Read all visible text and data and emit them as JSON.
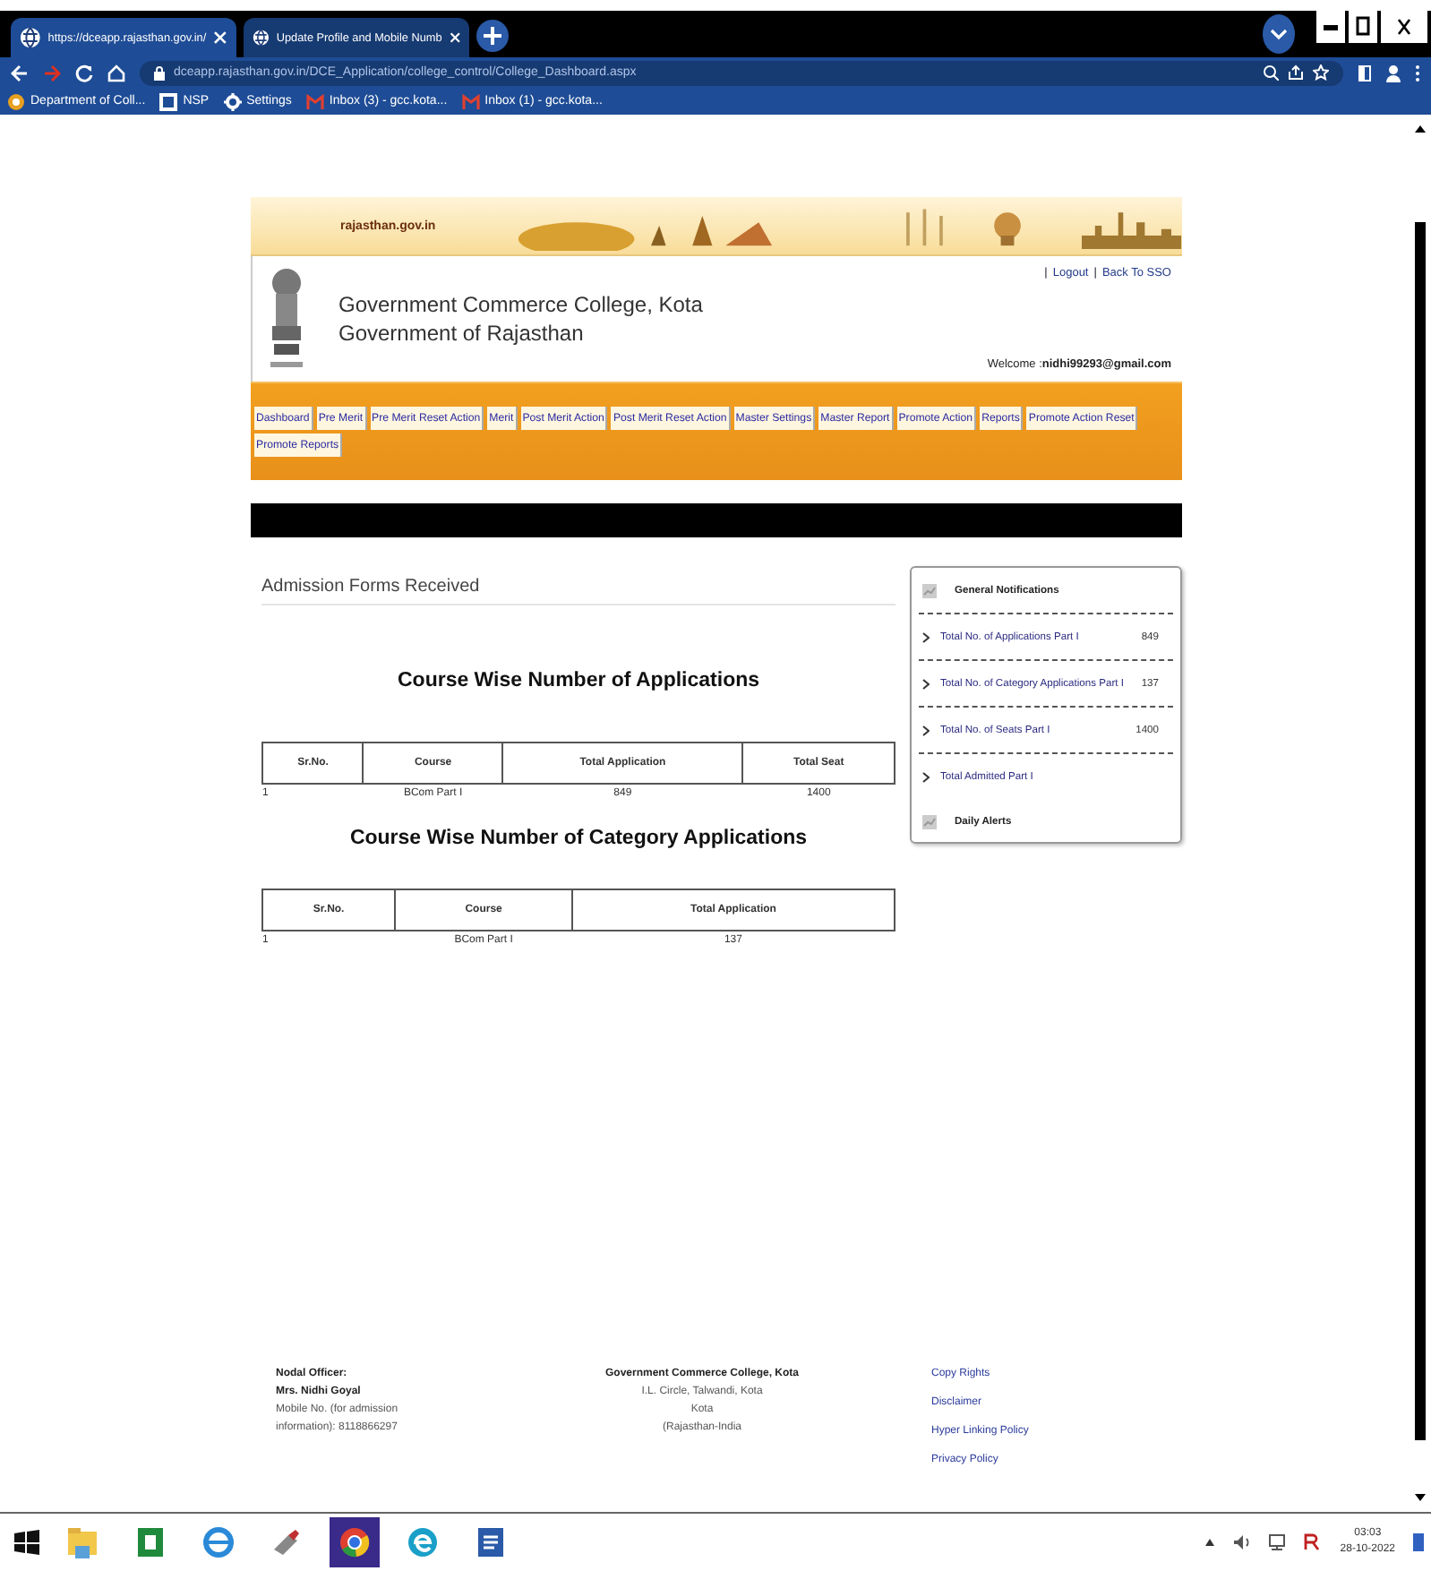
{
  "browser": {
    "tabs": [
      {
        "title": "https://dceapp.rajasthan.gov.in/",
        "selected": true
      },
      {
        "title": "Update Profile and Mobile Numb",
        "selected": false
      }
    ],
    "address": "dceapp.rajasthan.gov.in/DCE_Application/college_control/College_Dashboard.aspx",
    "bookmarks": [
      {
        "kind": "site",
        "label": "Department of Coll..."
      },
      {
        "kind": "nsp",
        "label": "NSP"
      },
      {
        "kind": "gear",
        "label": "Settings"
      },
      {
        "kind": "mail",
        "label": "Inbox (3) - gcc.kota..."
      },
      {
        "kind": "mail",
        "label": "Inbox (1) - gcc.kota..."
      }
    ]
  },
  "page": {
    "banner_text": "rajasthan.gov.in",
    "header_links": [
      "Logout",
      "Back To SSO"
    ],
    "link_separator": "|",
    "college": "Government Commerce College, Kota",
    "government": "Government of Rajasthan",
    "welcome_label": "Welcome :",
    "user": "nidhi99293@gmail.com",
    "nav": [
      "Dashboard",
      "Pre Merit",
      "Pre Merit Reset Action",
      "Merit",
      "Post Merit Action",
      "Post Merit Reset Action",
      "Master Settings",
      "Master Report",
      "Promote Action",
      "Reports",
      "Promote Action Reset",
      "Promote Reports"
    ],
    "section_title": "Admission Forms Received",
    "tables": [
      {
        "title": "Course Wise Number of Applications",
        "columns": [
          "Sr.No.",
          "Course",
          "Total Application",
          "Total Seat"
        ],
        "rows": [
          [
            "1",
            "BCom Part I",
            "849",
            "1400"
          ]
        ]
      },
      {
        "title": "Course Wise Number of Category Applications",
        "columns": [
          "Sr.No.",
          "Course",
          "Total Application"
        ],
        "rows": [
          [
            "1",
            "BCom Part I",
            "137"
          ]
        ]
      }
    ],
    "notifications": {
      "title": "General Notifications",
      "items": [
        {
          "label": "Total No. of Applications Part I",
          "count": "849"
        },
        {
          "label": "Total No. of Category Applications Part I",
          "count": "137"
        },
        {
          "label": "Total No. of Seats Part I",
          "count": "1400"
        },
        {
          "label": "Total Admitted Part I"
        }
      ],
      "alerts_title": "Daily Alerts"
    },
    "footer": {
      "officer_label": "Nodal Officer:",
      "officer_name": "Mrs. Nidhi Goyal",
      "mobile": "Mobile No. (for admission information): 8118866297",
      "address": [
        "Government Commerce College, Kota",
        "I.L. Circle, Talwandi, Kota",
        "Kota",
        "(Rajasthan-India"
      ],
      "links": [
        "Copy Rights",
        "Disclaimer",
        "Hyper Linking Policy",
        "Privacy Policy"
      ]
    }
  },
  "taskbar": {
    "apps": [
      {
        "kind": "explorer",
        "selected": false
      },
      {
        "kind": "sheet",
        "selected": false
      },
      {
        "kind": "ie",
        "selected": false
      },
      {
        "kind": "tool",
        "selected": false
      },
      {
        "kind": "chrome",
        "selected": true
      },
      {
        "kind": "edge",
        "selected": false
      },
      {
        "kind": "word",
        "selected": false
      }
    ],
    "time": "03:03",
    "date": "28-10-2022"
  }
}
